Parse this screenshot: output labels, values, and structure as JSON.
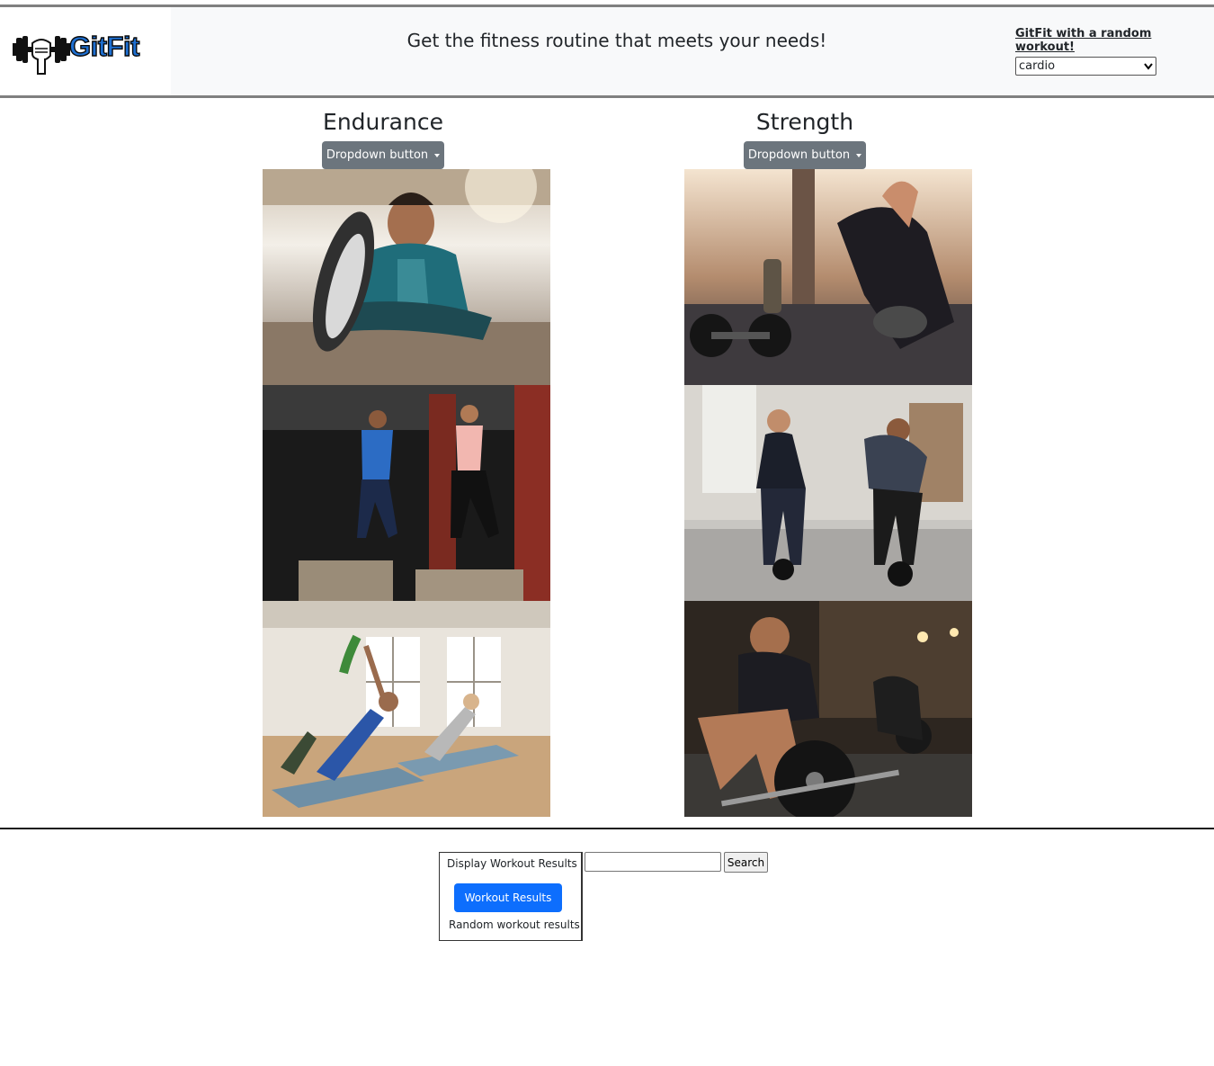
{
  "header": {
    "logo_text": "GitFit",
    "tagline": "Get the fitness routine that meets your needs!",
    "random_link": "GitFit with a random workout!",
    "random_select_value": "cardio"
  },
  "columns": [
    {
      "title": "Endurance",
      "dropdown_label": "Dropdown button",
      "photos": [
        "person-stretching-hamstring",
        "box-jump-training",
        "group-side-plank-yoga"
      ]
    },
    {
      "title": "Strength",
      "dropdown_label": "Dropdown button",
      "photos": [
        "woman-with-dumbbells",
        "couple-kettlebell-training",
        "woman-barbell-deadlift"
      ]
    }
  ],
  "results": {
    "heading": "Display Workout Results",
    "button_label": "Workout Results",
    "note": "Random workout results"
  },
  "search": {
    "placeholder": "",
    "button_label": "Search"
  },
  "colors": {
    "header_bg": "#f8f9fa",
    "secondary_button": "#6c757d",
    "primary_button": "#0d6efd",
    "logo_blue": "#1e6fd1"
  },
  "icons": [
    "dumbbell-fist-logo-icon",
    "dropdown-caret-icon"
  ]
}
